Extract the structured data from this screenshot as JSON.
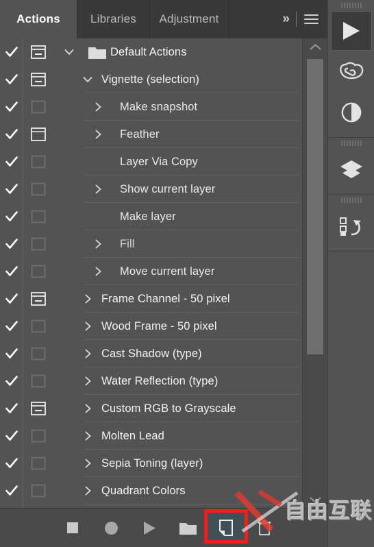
{
  "app": {
    "name": "Photoshop Actions Panel"
  },
  "tabs": [
    {
      "label": "Actions",
      "active": true
    },
    {
      "label": "Libraries",
      "active": false
    },
    {
      "label": "Adjustment",
      "active": false
    }
  ],
  "tab_tools": {
    "overflow_label": "»",
    "overflow_icon": "double-chevron-right-icon",
    "menu_icon": "hamburger-menu-icon"
  },
  "actions_list": [
    {
      "label": "Default Actions",
      "checked": true,
      "toggle": "dialog-minus",
      "expander": "chevron-down",
      "icon": "folder",
      "indent": 0
    },
    {
      "label": "Vignette (selection)",
      "checked": true,
      "toggle": "dialog-minus",
      "expander": "chevron-down",
      "icon": "none",
      "indent": 1
    },
    {
      "label": "Make snapshot",
      "checked": true,
      "toggle": "box-empty",
      "expander": "chevron-right",
      "icon": "none",
      "indent": 2
    },
    {
      "label": "Feather",
      "checked": true,
      "toggle": "box-bright",
      "expander": "chevron-right",
      "icon": "none",
      "indent": 2
    },
    {
      "label": "Layer Via Copy",
      "checked": true,
      "toggle": "box-empty",
      "expander": "none",
      "icon": "none",
      "indent": 2
    },
    {
      "label": "Show current layer",
      "checked": true,
      "toggle": "box-empty",
      "expander": "chevron-right",
      "icon": "none",
      "indent": 2
    },
    {
      "label": "Make layer",
      "checked": true,
      "toggle": "box-empty",
      "expander": "none",
      "icon": "none",
      "indent": 2
    },
    {
      "label": "Fill",
      "checked": true,
      "toggle": "box-empty",
      "expander": "chevron-right",
      "icon": "none",
      "indent": 2
    },
    {
      "label": "Move current layer",
      "checked": true,
      "toggle": "box-empty",
      "expander": "chevron-right",
      "icon": "none",
      "indent": 2
    },
    {
      "label": "Frame Channel - 50 pixel",
      "checked": true,
      "toggle": "dialog-minus",
      "expander": "chevron-right",
      "icon": "none",
      "indent": 1
    },
    {
      "label": "Wood Frame - 50 pixel",
      "checked": true,
      "toggle": "box-empty",
      "expander": "chevron-right",
      "icon": "none",
      "indent": 1
    },
    {
      "label": "Cast Shadow (type)",
      "checked": true,
      "toggle": "box-empty",
      "expander": "chevron-right",
      "icon": "none",
      "indent": 1
    },
    {
      "label": "Water Reflection (type)",
      "checked": true,
      "toggle": "box-empty",
      "expander": "chevron-right",
      "icon": "none",
      "indent": 1
    },
    {
      "label": "Custom RGB to Grayscale",
      "checked": true,
      "toggle": "dialog-minus",
      "expander": "chevron-right",
      "icon": "none",
      "indent": 1
    },
    {
      "label": "Molten Lead",
      "checked": true,
      "toggle": "box-empty",
      "expander": "chevron-right",
      "icon": "none",
      "indent": 1
    },
    {
      "label": "Sepia Toning (layer)",
      "checked": true,
      "toggle": "box-empty",
      "expander": "chevron-right",
      "icon": "none",
      "indent": 1
    },
    {
      "label": "Quadrant Colors",
      "checked": true,
      "toggle": "box-empty",
      "expander": "chevron-right",
      "icon": "none",
      "indent": 1
    }
  ],
  "scrollbar": {
    "up_icon": "chevron-up-icon",
    "down_icon": "chevron-down-icon",
    "thumb_position_percent": 0,
    "thumb_size_percent": 68
  },
  "bottom_toolbar": [
    {
      "name": "stop-button",
      "icon": "stop-square-icon",
      "selected": false,
      "highlighted": false
    },
    {
      "name": "record-button",
      "icon": "record-circle-icon",
      "selected": false,
      "highlighted": false
    },
    {
      "name": "play-button",
      "icon": "play-triangle-icon",
      "selected": false,
      "highlighted": false
    },
    {
      "name": "new-set-button",
      "icon": "folder-icon",
      "selected": false,
      "highlighted": false
    },
    {
      "name": "new-action-button",
      "icon": "new-page-icon",
      "selected": true,
      "highlighted": true
    },
    {
      "name": "delete-button",
      "icon": "trash-icon",
      "selected": false,
      "highlighted": false
    }
  ],
  "right_rail": [
    {
      "name": "play-panel-icon",
      "icon": "play-triangle-icon",
      "active": true,
      "group": 0
    },
    {
      "name": "creative-cloud-icon",
      "icon": "creative-cloud-icon",
      "active": false,
      "group": 0
    },
    {
      "name": "adjustments-icon",
      "icon": "half-circle-icon",
      "active": false,
      "group": 0
    },
    {
      "name": "layers-icon",
      "icon": "layers-stack-icon",
      "active": false,
      "group": 1
    },
    {
      "name": "history-icon",
      "icon": "history-undo-icon",
      "active": false,
      "group": 2
    }
  ],
  "watermark": {
    "text": "自由互联",
    "mark": "red-x-slash"
  },
  "colors": {
    "panel_bg": "#535353",
    "tabstrip_bg": "#393939",
    "toolbar_bg": "#4a4a4a",
    "text": "#e9e9e9",
    "separator": "#616161",
    "highlight_red": "#f41c18",
    "selected_teal": "#3f5156"
  }
}
